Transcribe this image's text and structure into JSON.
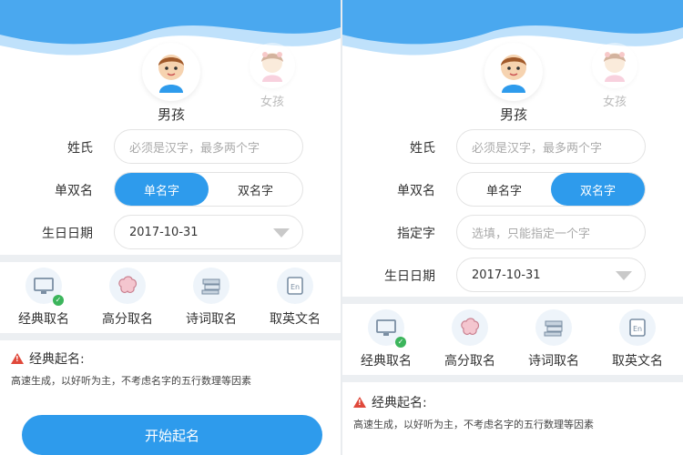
{
  "colors": {
    "accent": "#2e9bec",
    "wave_light": "#bfe1fb",
    "wave_dark": "#4aa8ef",
    "warning": "#e0493b"
  },
  "left": {
    "gender": {
      "boy": "男孩",
      "girl": "女孩",
      "selected": "boy"
    },
    "surname": {
      "label": "姓氏",
      "placeholder": "必须是汉字，最多两个字"
    },
    "name_type": {
      "label": "单双名",
      "options": [
        "单名字",
        "双名字"
      ],
      "selected": "单名字"
    },
    "birthday": {
      "label": "生日日期",
      "value": "2017-10-31"
    },
    "features": [
      {
        "label": "经典取名",
        "icon": "monitor-icon",
        "checked": true
      },
      {
        "label": "高分取名",
        "icon": "brain-icon",
        "checked": false
      },
      {
        "label": "诗词取名",
        "icon": "books-icon",
        "checked": false
      },
      {
        "label": "取英文名",
        "icon": "english-card-icon",
        "checked": false
      }
    ],
    "info": {
      "title": "经典起名:",
      "desc": "高速生成，以好听为主，不考虑名字的五行数理等因素"
    },
    "start_button": "开始起名"
  },
  "right": {
    "gender": {
      "boy": "男孩",
      "girl": "女孩",
      "selected": "boy"
    },
    "surname": {
      "label": "姓氏",
      "placeholder": "必须是汉字，最多两个字"
    },
    "name_type": {
      "label": "单双名",
      "options": [
        "单名字",
        "双名字"
      ],
      "selected": "双名字"
    },
    "specified_char": {
      "label": "指定字",
      "placeholder": "选填，只能指定一个字"
    },
    "birthday": {
      "label": "生日日期",
      "value": "2017-10-31"
    },
    "features": [
      {
        "label": "经典取名",
        "icon": "monitor-icon",
        "checked": true
      },
      {
        "label": "高分取名",
        "icon": "brain-icon",
        "checked": false
      },
      {
        "label": "诗词取名",
        "icon": "books-icon",
        "checked": false
      },
      {
        "label": "取英文名",
        "icon": "english-card-icon",
        "checked": false
      }
    ],
    "info": {
      "title": "经典起名:",
      "desc": "高速生成，以好听为主，不考虑名字的五行数理等因素"
    }
  }
}
